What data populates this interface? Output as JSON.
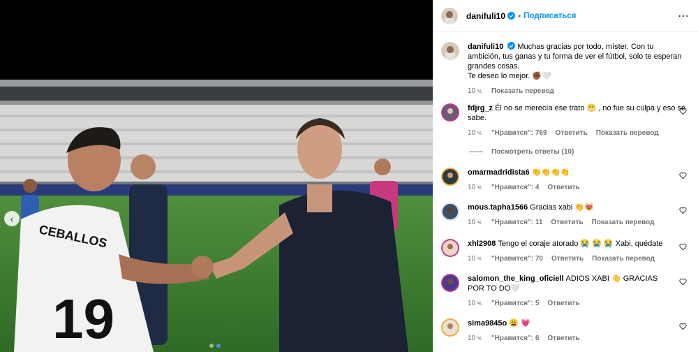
{
  "colors": {
    "accent": "#0095f6",
    "verified": "#0095f6",
    "muted": "#737373"
  },
  "post": {
    "author": "danifuli10",
    "follow_label": "Подписаться",
    "more_icon": "more-horizontal-icon"
  },
  "caption": {
    "username": "danifuli10",
    "text_line1": "Muchas gracias por todo, míster. Con tu ambición, tus ganas y tu forma de ver el fútbol, solo te esperan grandes cosas.",
    "text_line2": "Te deseo lo mejor. ✊🏾🤍",
    "time": "10 ч.",
    "translate": "Показать перевод"
  },
  "comments": [
    {
      "username": "fdjrg_z",
      "text": "Él no se merecía ese trato 😬 , no fue su culpa y eso se sabe.",
      "time": "10 ч.",
      "likes": "\"Нравится\": 769",
      "reply": "Ответить",
      "translate": "Показать перевод",
      "replies": "Посмотреть ответы (10)"
    },
    {
      "username": "omarmadridista6",
      "text": "👏👏👏👏",
      "time": "10 ч.",
      "likes": "\"Нравится\": 4",
      "reply": "Ответить",
      "translate": ""
    },
    {
      "username": "mous.tapha1566",
      "text": "Gracias xabi 👏😻",
      "time": "10 ч.",
      "likes": "\"Нравится\": 11",
      "reply": "Ответить",
      "translate": "Показать перевод"
    },
    {
      "username": "xhl2908",
      "text": "Tengo el coraje atorado 😭 😭 😭 Xabi, quédate",
      "time": "10 ч.",
      "likes": "\"Нравится\": 70",
      "reply": "Ответить",
      "translate": "Показать перевод"
    },
    {
      "username": "salomon_the_king_oficiell",
      "text": "ADIOS XABI 👋 GRACIAS POR TO DO🤍",
      "time": "10 ч.",
      "likes": "\"Нравится\": 5",
      "reply": "Ответить",
      "translate": ""
    },
    {
      "username": "sima9845o",
      "text": "😩 💗",
      "time": "10 ч.",
      "likes": "\"Нравится\": 6",
      "reply": "Ответить",
      "translate": ""
    }
  ],
  "media": {
    "jersey_name": "CEBALLOS",
    "jersey_number": "19",
    "carousel_index": 1,
    "carousel_count": 2
  }
}
